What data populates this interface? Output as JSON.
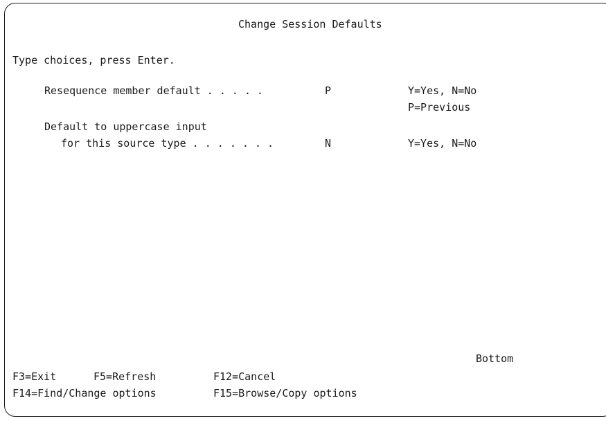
{
  "screen": {
    "title": "Change Session Defaults",
    "instruction": "Type choices, press Enter."
  },
  "fields": [
    {
      "label": "Resequence member default . . . . .",
      "value": "P",
      "choices": [
        "Y=Yes, N=No",
        "P=Previous"
      ]
    },
    {
      "label_line1": "Default to uppercase input",
      "label_line2": "for this source type . . . . . . .",
      "value": "N",
      "choices": [
        "Y=Yes, N=No"
      ]
    }
  ],
  "status": {
    "position": "Bottom"
  },
  "function_keys": {
    "f3": "F3=Exit",
    "f5": "F5=Refresh",
    "f12": "F12=Cancel",
    "f14": "F14=Find/Change options",
    "f15": "F15=Browse/Copy options"
  }
}
